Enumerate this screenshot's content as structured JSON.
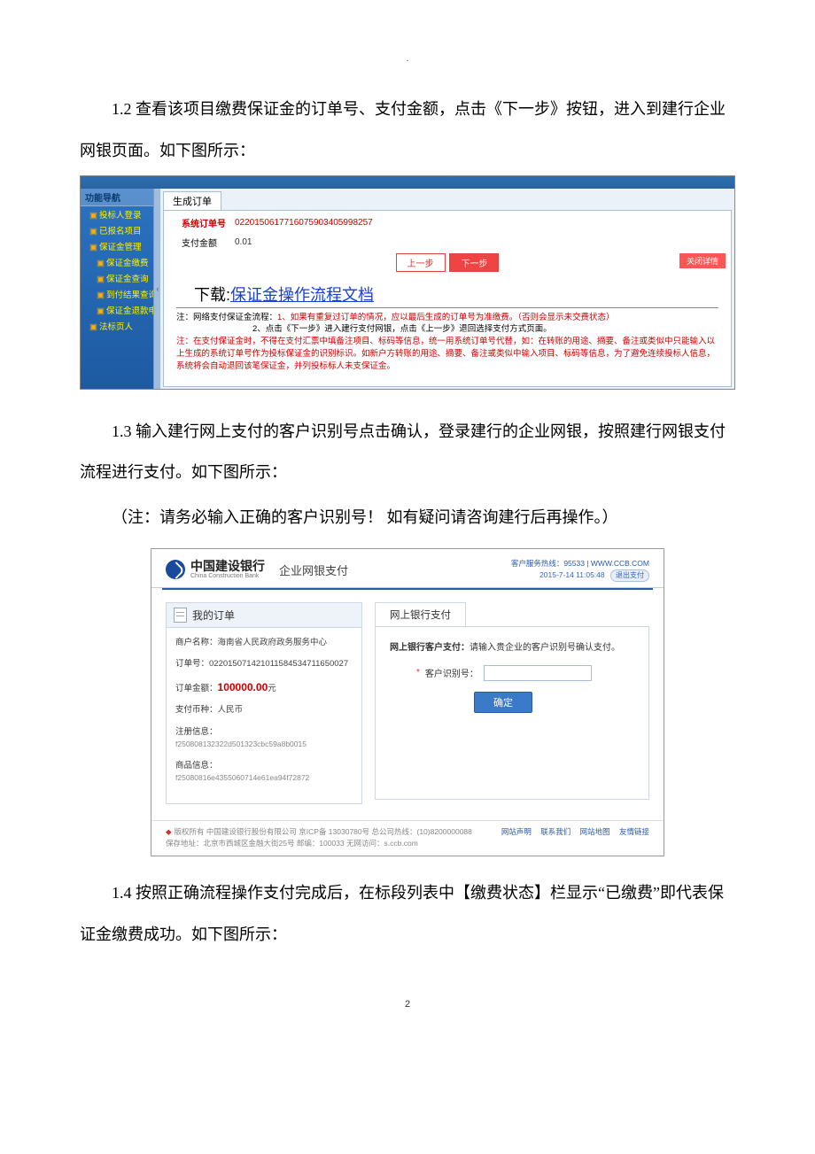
{
  "page_number": "2",
  "paragraphs": {
    "p12": "1.2 查看该项目缴费保证金的订单号、支付金额，点击《下一步》按钮，进入到建行企业网银页面。如下图所示：",
    "p13": "1.3 输入建行网上支付的客户识别号点击确认，登录建行的企业网银，按照建行网银支付流程进行支付。如下图所示：",
    "note": "（注：请务必输入正确的客户识别号！ 如有疑问请咨询建行后再操作。）",
    "p14": "1.4 按照正确流程操作支付完成后，在标段列表中【缴费状态】栏显示“已缴费”即代表保证金缴费成功。如下图所示："
  },
  "shot1": {
    "nav_header": "功能导航",
    "nav_items": [
      "投标人登录",
      "已报名项目",
      "保证金管理",
      "保证金缴费",
      "保证金查询",
      "到付结果查询",
      "保证金退款申请",
      "法标页人"
    ],
    "tab": "生成订单",
    "row_order_label": "系统订单号",
    "row_order_value": "0220150617716075903405998257",
    "row_amount_label": "支付金额",
    "row_amount_value": "0.01",
    "btn_prev": "上一步",
    "btn_next": "下一步",
    "btn_close": "关闭详情",
    "download_label": "下载:",
    "download_link": "保证金操作流程文档",
    "warn1_head": "注：网络支付保证金流程：",
    "warn1_a": "1、如果有重复过订单的情况，应以最后生成的订单号为准缴费。（否则会显示未交费状态）",
    "warn1_b": "2、点击《下一步》进入建行支付网银，点击《上一步》退回选择支付方式页面。",
    "warn2": "注：在支付保证金时，不得在支付汇票中填备注项目、标码等信息，统一用系统订单号代替，如：在转账的用途、摘要、备注或类似中只能输入以上生成的系统订单号作为投标保证金的识别标识。如新户方转账的用途、摘要、备注或类似中输入项目、标码等信息，为了避免连续投标人信息，系统将会自动退回该笔保证金，并列投标标人未支保证金。"
  },
  "shot2": {
    "hotline": "客户服务热线：95533 | WWW.CCB.COM",
    "datetime": "2015-7-14 11:05:48",
    "badge": "退出支付",
    "bank_cn": "中国建设银行",
    "bank_en": "China Construction Bank",
    "title": "企业网银支付",
    "left_header": "我的订单",
    "merchant_label": "商户名称：",
    "merchant_value": "海南省人民政府政务服务中心",
    "order_label": "订单号：",
    "order_value": "022015071421011584534711650027",
    "amount_label": "订单金额：",
    "amount_value": "100000.00",
    "amount_unit": "元",
    "currency_label": "支付币种：",
    "currency_value": "人民币",
    "remark_label": "注册信息：",
    "remark_value": "f250808132322d501323cbc59a8b0015",
    "goods_label": "商品信息：",
    "goods_value": "f25080816e4355060714e61ea94f72872",
    "tab": "网上银行支付",
    "line1_bold": "网上银行客户支付：",
    "line1_rest": "请输入贵企业的客户识别号确认支付。",
    "input_label": "客户识别号：",
    "confirm": "确定",
    "footer1": "版权所有 中国建设银行股份有限公司 京ICP备 13030780号  总公司热线：(10)8200000088",
    "footer2": "保存地址：北京市西城区金融大街25号    邮编：100033    无网访问：s.ccb.com",
    "footer_links": [
      "网站声明",
      "联系我们",
      "网站地图",
      "友情链接"
    ]
  }
}
